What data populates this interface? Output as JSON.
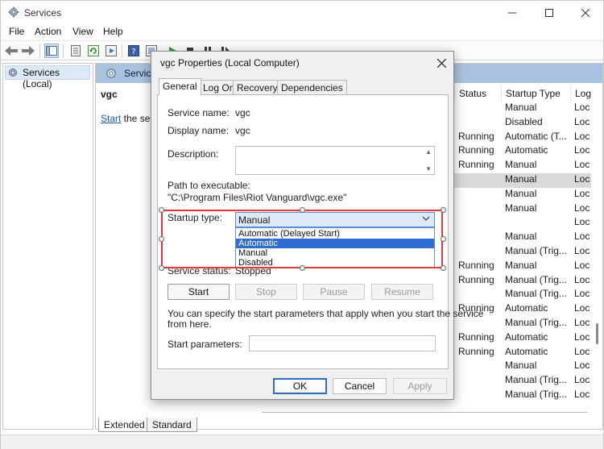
{
  "window": {
    "title": "Services",
    "menu": [
      "File",
      "Action",
      "View",
      "Help"
    ]
  },
  "tree": {
    "root_label": "Services (Local)"
  },
  "right_pane": {
    "header_label": "Service",
    "selected_name": "vgc",
    "start_link": "Start",
    "start_link_suffix": " the serv",
    "columns": [
      "Status",
      "Startup Type",
      "Log"
    ],
    "rows": [
      {
        "status": "",
        "startup": "Manual",
        "log": "Loc"
      },
      {
        "status": "",
        "startup": "Disabled",
        "log": "Loc"
      },
      {
        "status": "Running",
        "startup": "Automatic (T...",
        "log": "Loc"
      },
      {
        "status": "Running",
        "startup": "Automatic",
        "log": "Loc"
      },
      {
        "status": "Running",
        "startup": "Manual",
        "log": "Loc"
      },
      {
        "status": "",
        "startup": "Manual",
        "log": "Loc",
        "selected": true
      },
      {
        "status": "",
        "startup": "Manual",
        "log": "Loc"
      },
      {
        "status": "",
        "startup": "Manual",
        "log": "Loc"
      },
      {
        "status": "",
        "startup": "",
        "log": "Loc"
      },
      {
        "status": "",
        "startup": "Manual",
        "log": "Loc"
      },
      {
        "status": "",
        "startup": "Manual (Trig...",
        "log": "Loc"
      },
      {
        "status": "Running",
        "startup": "Manual",
        "log": "Loc"
      },
      {
        "status": "Running",
        "startup": "Manual (Trig...",
        "log": "Loc"
      },
      {
        "status": "",
        "startup": "Manual (Trig...",
        "log": "Loc"
      },
      {
        "status": "Running",
        "startup": "Automatic",
        "log": "Loc"
      },
      {
        "status": "",
        "startup": "Manual (Trig...",
        "log": "Loc"
      },
      {
        "status": "Running",
        "startup": "Automatic",
        "log": "Loc"
      },
      {
        "status": "Running",
        "startup": "Automatic",
        "log": "Loc"
      },
      {
        "status": "",
        "startup": "Manual",
        "log": "Loc"
      },
      {
        "status": "",
        "startup": "Manual (Trig...",
        "log": "Loc"
      },
      {
        "status": "",
        "startup": "Manual (Trig...",
        "log": "Loc"
      }
    ]
  },
  "bottom_tabs": [
    "Extended",
    "Standard"
  ],
  "dialog": {
    "title": "vgc Properties (Local Computer)",
    "tabs": [
      "General",
      "Log On",
      "Recovery",
      "Dependencies"
    ],
    "service_name_label": "Service name:",
    "service_name": "vgc",
    "display_name_label": "Display name:",
    "display_name": "vgc",
    "description_label": "Description:",
    "path_label": "Path to executable:",
    "path": "\"C:\\Program Files\\Riot Vanguard\\vgc.exe\"",
    "startup_type_label": "Startup type:",
    "startup_type_value": "Manual",
    "startup_options": [
      "Automatic (Delayed Start)",
      "Automatic",
      "Manual",
      "Disabled"
    ],
    "startup_selected_index": 1,
    "service_status_label": "Service status:",
    "service_status": "Stopped",
    "buttons": {
      "start": "Start",
      "stop": "Stop",
      "pause": "Pause",
      "resume": "Resume"
    },
    "hint": "You can specify the start parameters that apply when you start the service",
    "hint_line2": "from here.",
    "start_params_label": "Start parameters:",
    "ok": "OK",
    "cancel": "Cancel",
    "apply": "Apply"
  },
  "colors": {
    "highlight_box": "#e03a3a",
    "selection": "#2f6cd2",
    "pane_header": "#a9c3df"
  }
}
